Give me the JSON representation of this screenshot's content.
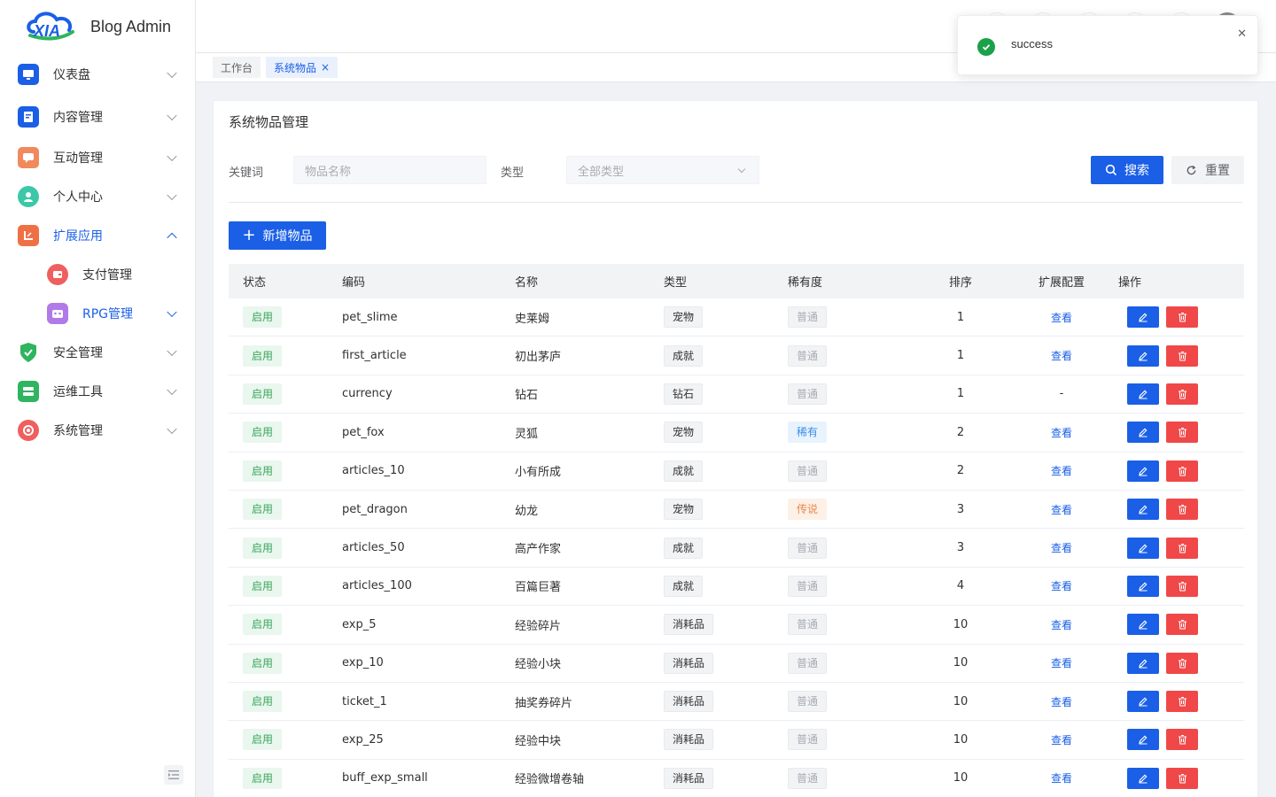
{
  "app": {
    "title": "Blog Admin",
    "logo_text": "XIA"
  },
  "sidebar": {
    "items": [
      {
        "label": "仪表盘",
        "icon": "monitor-icon",
        "color": "#1a5fe6"
      },
      {
        "label": "内容管理",
        "icon": "document-icon",
        "color": "#1a5fe6"
      },
      {
        "label": "互动管理",
        "icon": "chat-icon",
        "color": "#f08a5d"
      },
      {
        "label": "个人中心",
        "icon": "user-icon",
        "color": "#3cc8a8"
      },
      {
        "label": "扩展应用",
        "icon": "app-extend-icon",
        "color": "#f07045"
      },
      {
        "label": "支付管理",
        "icon": "wallet-icon",
        "color": "#ef5f5f"
      },
      {
        "label": "RPG管理",
        "icon": "game-icon",
        "color": "#b07ae8"
      },
      {
        "label": "安全管理",
        "icon": "shield-icon",
        "color": "#2fb45f"
      },
      {
        "label": "运维工具",
        "icon": "server-icon",
        "color": "#2fb45f"
      },
      {
        "label": "系统管理",
        "icon": "settings-icon",
        "color": "#ef5f5f"
      }
    ]
  },
  "tabs": [
    {
      "label": "工作台"
    },
    {
      "label": "系统物品"
    }
  ],
  "page": {
    "title": "系统物品管理",
    "keyword_label": "关键词",
    "keyword_placeholder": "物品名称",
    "type_label": "类型",
    "type_value": "全部类型",
    "search_label": "搜索",
    "reset_label": "重置",
    "add_label": "新增物品"
  },
  "table": {
    "headers": [
      "状态",
      "编码",
      "名称",
      "类型",
      "稀有度",
      "排序",
      "扩展配置",
      "操作"
    ],
    "rows": [
      {
        "status": "启用",
        "code": "pet_slime",
        "name": "史莱姆",
        "type": "宠物",
        "rarity": "普通",
        "rarity_kind": "normal",
        "sort": "1",
        "ext": "查看"
      },
      {
        "status": "启用",
        "code": "first_article",
        "name": "初出茅庐",
        "type": "成就",
        "rarity": "普通",
        "rarity_kind": "normal",
        "sort": "1",
        "ext": "查看"
      },
      {
        "status": "启用",
        "code": "currency",
        "name": "钻石",
        "type": "钻石",
        "rarity": "普通",
        "rarity_kind": "normal",
        "sort": "1",
        "ext": "-"
      },
      {
        "status": "启用",
        "code": "pet_fox",
        "name": "灵狐",
        "type": "宠物",
        "rarity": "稀有",
        "rarity_kind": "rare",
        "sort": "2",
        "ext": "查看"
      },
      {
        "status": "启用",
        "code": "articles_10",
        "name": "小有所成",
        "type": "成就",
        "rarity": "普通",
        "rarity_kind": "normal",
        "sort": "2",
        "ext": "查看"
      },
      {
        "status": "启用",
        "code": "pet_dragon",
        "name": "幼龙",
        "type": "宠物",
        "rarity": "传说",
        "rarity_kind": "legend",
        "sort": "3",
        "ext": "查看"
      },
      {
        "status": "启用",
        "code": "articles_50",
        "name": "高产作家",
        "type": "成就",
        "rarity": "普通",
        "rarity_kind": "normal",
        "sort": "3",
        "ext": "查看"
      },
      {
        "status": "启用",
        "code": "articles_100",
        "name": "百篇巨著",
        "type": "成就",
        "rarity": "普通",
        "rarity_kind": "normal",
        "sort": "4",
        "ext": "查看"
      },
      {
        "status": "启用",
        "code": "exp_5",
        "name": "经验碎片",
        "type": "消耗品",
        "rarity": "普通",
        "rarity_kind": "normal",
        "sort": "10",
        "ext": "查看"
      },
      {
        "status": "启用",
        "code": "exp_10",
        "name": "经验小块",
        "type": "消耗品",
        "rarity": "普通",
        "rarity_kind": "normal",
        "sort": "10",
        "ext": "查看"
      },
      {
        "status": "启用",
        "code": "ticket_1",
        "name": "抽奖券碎片",
        "type": "消耗品",
        "rarity": "普通",
        "rarity_kind": "normal",
        "sort": "10",
        "ext": "查看"
      },
      {
        "status": "启用",
        "code": "exp_25",
        "name": "经验中块",
        "type": "消耗品",
        "rarity": "普通",
        "rarity_kind": "normal",
        "sort": "10",
        "ext": "查看"
      },
      {
        "status": "启用",
        "code": "buff_exp_small",
        "name": "经验微增卷轴",
        "type": "消耗品",
        "rarity": "普通",
        "rarity_kind": "normal",
        "sort": "10",
        "ext": "查看"
      }
    ]
  },
  "toast": {
    "message": "success",
    "type": "success"
  },
  "colors": {
    "primary": "#1a5fe6",
    "danger": "#f04848",
    "success": "#1aa14a"
  }
}
